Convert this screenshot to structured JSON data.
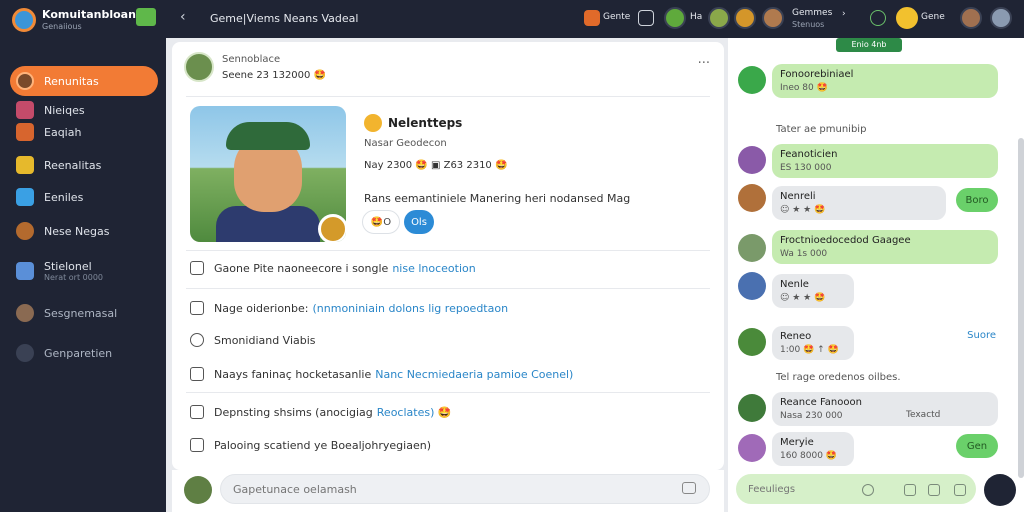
{
  "sidebar": {
    "title": "Komuitanbloann",
    "subtitle": "Genaiious",
    "items": [
      {
        "label": "Renunitas"
      },
      {
        "label": "Nieiqes"
      },
      {
        "label": "Eaqiah"
      },
      {
        "label": "Reenalitas"
      },
      {
        "label": "Eeniles"
      },
      {
        "label": "Nese Negas"
      },
      {
        "label": "Stielonel",
        "sub": "Nerat ort 0000"
      },
      {
        "label": "Sesgnemasal"
      },
      {
        "label": "Genparetien"
      }
    ]
  },
  "topbar": {
    "back": "‹",
    "title": "Geme|Viems Neans Vadeal",
    "label1": "Gente",
    "label2": "Ha",
    "user": "Gemmes",
    "user_sub": "Stenuos",
    "user2": "Gene"
  },
  "post": {
    "name": "Sennoblace",
    "meta": "Seene 23 132000 🤩",
    "more": "···",
    "card": {
      "title": "Nelentteps",
      "subtitle": "Nasar Geodecon",
      "stats": "Nay 2300 🤩 ▣ Z63 2310 🤩",
      "desc": "Rans eemantiniele Manering heri nodansed Mag",
      "pill1": "🤩O",
      "pill2": "Ols"
    },
    "rows": [
      {
        "text": "Gaone Pite naoneecore i songle",
        "link": "nise lnoceotion"
      },
      {
        "text": "Nage oiderionbe:",
        "link": "(nnmoniniain dolons lig repoedtaon"
      },
      {
        "text": "Smonidiand Viabis",
        "link": ""
      },
      {
        "text": "Naays faninaç hocketasanlie",
        "link": "Nanc Necmiedaeria pamioe  Coenel)"
      },
      {
        "text": "Depnsting shsims (anocigiag",
        "link": "Reoclates) 🤩"
      },
      {
        "text": "Palooing scatiend ye Boealjohryegiaen)",
        "link": ""
      }
    ]
  },
  "composer": {
    "placeholder": "Gapetunace oelamash"
  },
  "chat": {
    "header": "Enio 4nb",
    "messages": [
      {
        "text": "Fonoorebiniael",
        "sub": "Ineo 80 🤩"
      },
      {
        "sys": "Tater ae pmunibip"
      },
      {
        "text": "Feanoticien",
        "sub": "ES 130 000"
      },
      {
        "text": "Nenreli",
        "sub": "☺ ★ ★ 🤩",
        "action": "Boro"
      },
      {
        "text": "Froctnioedocedod Gaagee",
        "sub": "Wa 1s 000"
      },
      {
        "text": "Nenle",
        "sub": "☺ ★ ★ 🤩"
      },
      {
        "text": "Reneo",
        "sub": "1:00 🤩 ↑ 🤩",
        "action": "Suore"
      },
      {
        "sys": "Tel rage oredenos oilbes."
      },
      {
        "text": "Reance Fanooon",
        "sub": "Nasa 230 000",
        "side": "Texactd"
      },
      {
        "text": "Meryie",
        "sub": "160 8000 🤩",
        "action": "Gen"
      }
    ],
    "input_placeholder": "Feeuliegs"
  },
  "colors": {
    "sidebar": "#1f2434",
    "accent": "#f27b35",
    "bubble_green": "#c5ebb0",
    "link": "#2a86c8"
  }
}
